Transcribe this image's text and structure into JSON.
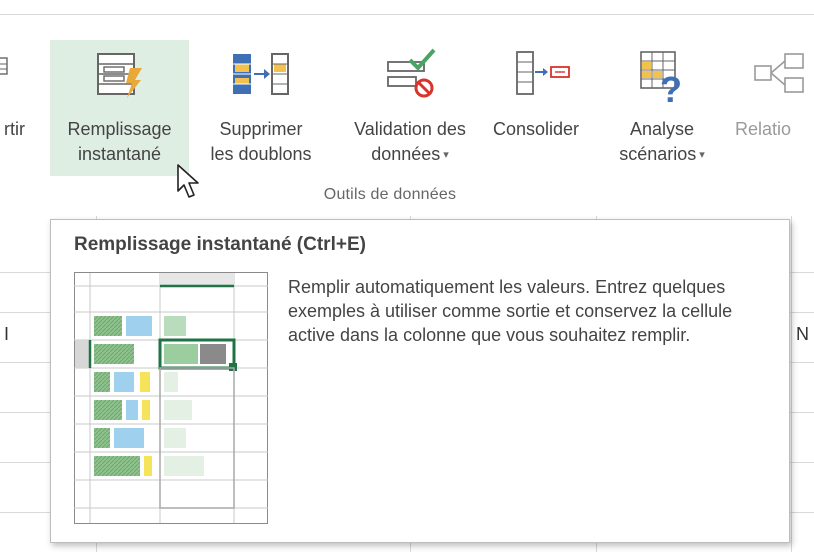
{
  "ribbon": {
    "partial_left_label": "rtir",
    "commands": [
      {
        "id": "flash-fill",
        "line1": "Remplissage",
        "line2": "instantané",
        "icon": "flash-fill-icon",
        "highlighted": true
      },
      {
        "id": "remove-duplicates",
        "line1": "Supprimer",
        "line2": "les doublons",
        "icon": "remove-duplicates-icon"
      },
      {
        "id": "data-validation",
        "line1": "Validation des",
        "line2": "données",
        "icon": "data-validation-icon",
        "dropdown": true
      },
      {
        "id": "consolidate",
        "line1": "Consolider",
        "line2": "",
        "icon": "consolidate-icon"
      },
      {
        "id": "what-if",
        "line1": "Analyse",
        "line2": "scénarios",
        "icon": "what-if-analysis-icon",
        "dropdown": true
      },
      {
        "id": "relationships",
        "line1": "Relatio",
        "line2": "",
        "icon": "relationships-icon",
        "disabled": true
      }
    ],
    "group_label": "Outils de données",
    "dropdown_glyph": "▾"
  },
  "sheet": {
    "col_left": "I",
    "col_right": "N"
  },
  "tooltip": {
    "title": "Remplissage instantané (Ctrl+E)",
    "body": "Remplir automatiquement les valeurs. Entrez quelques exemples à utiliser comme sortie et conservez la cellule active dans la colonne que vous souhaitez remplir."
  },
  "colors": {
    "highlight": "#dfeee3",
    "excel_green": "#217346",
    "icon_gold": "#e8a83a",
    "icon_blue": "#3f6fb5",
    "icon_red": "#d9342b",
    "icon_green": "#4aa564"
  }
}
